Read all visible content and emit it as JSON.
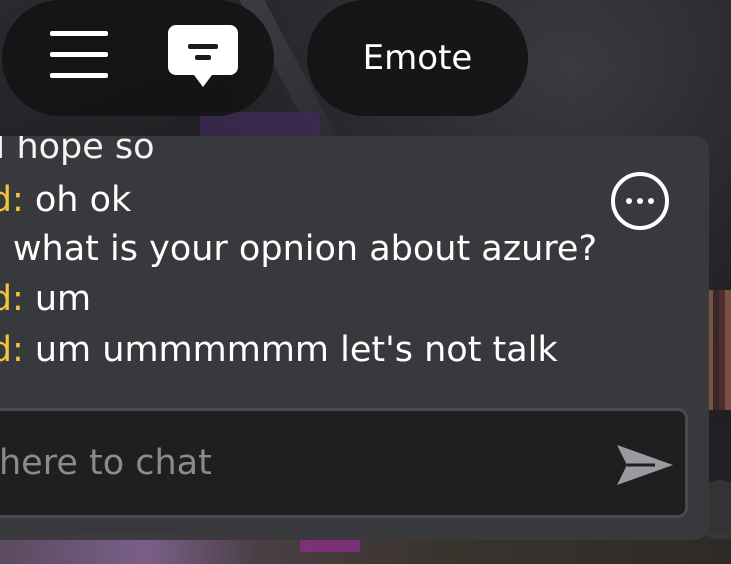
{
  "topbar": {
    "menu_icon": "hamburger-icon",
    "chat_icon": "chat-bubble-icon",
    "emote_label": "Emote"
  },
  "chat": {
    "messages": [
      {
        "name": "",
        "text": "I hope so"
      },
      {
        "name": "id:",
        "text": " oh ok"
      },
      {
        "name": ":",
        "text": " what is your opnion about azure?"
      },
      {
        "name": "id:",
        "text": " um"
      },
      {
        "name": "id:",
        "text": " um ummmmmm let's not talk"
      }
    ],
    "more_icon": "more-options-icon",
    "input_placeholder": "here to chat",
    "send_icon": "send-arrow-icon"
  },
  "colors": {
    "name": "#f3c43c",
    "text": "#ffffff",
    "panel": "#393a3d",
    "input_bg": "#1e1f21",
    "placeholder": "#8a8b8e"
  }
}
